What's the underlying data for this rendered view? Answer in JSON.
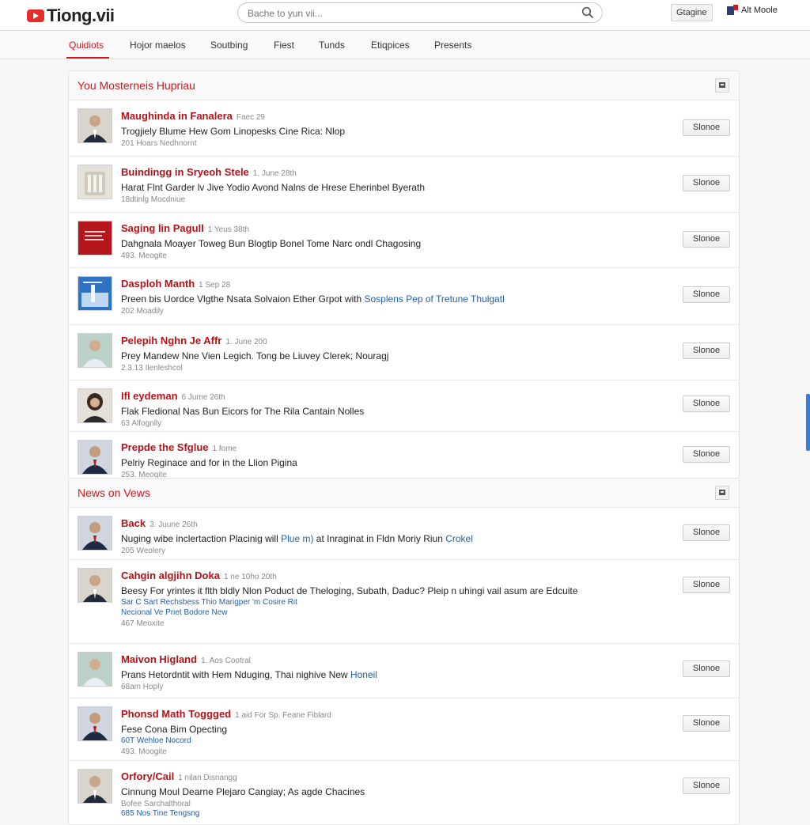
{
  "header": {
    "logo_text": "Tiong.vii",
    "search_placeholder": "Bache to yun vii...",
    "top_button": "Gtagine",
    "user_label": "Alt Moole"
  },
  "nav": {
    "tabs": [
      "Quidiots",
      "Hojor maelos",
      "Soutbing",
      "Fiest",
      "Tunds",
      "Etiqpices",
      "Presents"
    ],
    "active_index": 0
  },
  "panels": [
    {
      "title": "You Mosterneis Hupriau",
      "rows": [
        {
          "title": "Maughinda in Fanalera",
          "date": "Faec 29",
          "desc": "Trogjiely Blume Hew Gom Linopesks Cine Rica: Nlop",
          "meta": "201 Hoars Nedhnornt",
          "button": "Slonoe",
          "thumb": "person-dark"
        },
        {
          "title": "Buindingg in Sryeoh Stele",
          "date": "1. June 28th",
          "desc": "Harat Flnt Garder lv Jive Yodio Avond Nalns de Hrese Eherinbel Byerath",
          "meta": "18dtinlg Mocdniue",
          "button": "Slonoe",
          "thumb": "building"
        },
        {
          "title": "Saging lin Pagull",
          "date": "1 Yeus 38th",
          "desc": "Dahgnala Moayer Toweg Bun Blogtip Bonel Tome Narc ondl Chagosing",
          "meta": "493. Meogite",
          "button": "Slonoe",
          "thumb": "red-cover"
        },
        {
          "title": "Dasploh Manth",
          "date": "1 Sep 28",
          "desc": "Preen bis Uordce Vlgthe Nsata Solvaion Ether Grpot with",
          "desc_link": "Sosplens Pep of Tretune Thulgatl",
          "meta": "202 Moadily",
          "button": "Slonoe",
          "thumb": "blue-cover"
        },
        {
          "title": "Pelepih Nghn Je Affr",
          "date": "1. June 200",
          "desc": "Prey Mandew Nne Vien Legich. Tong be Liuvey Clerek; Nouragj",
          "meta": "2.3.13 Ilenleshcol",
          "button": "Slonoe",
          "thumb": "person-light"
        },
        {
          "title": "Ifl eydeman",
          "date": "6 Jume 26th",
          "desc": "Flak Fledional Nas Bun Eicors for The Rila Cantain Nolles",
          "meta": "63 Alfognlly",
          "button": "Slonoe",
          "thumb": "woman"
        },
        {
          "title": "Prepde the Sfglue",
          "date": "1 fome",
          "desc": "Pelriy Reginace and for in the Llion Pigina",
          "meta": "253. Meogite",
          "button": "Slonoe",
          "thumb": "person-suit"
        }
      ]
    },
    {
      "title": "News on Vews",
      "rows": [
        {
          "title": "Back",
          "date": "3. Juune 26th",
          "desc": "Nuging wibe inclertaction Placinig will",
          "desc_link": "Plue m)",
          "desc_tail": "at Inraginat in Fldn Moriy Riun",
          "desc_link2": "Crokel",
          "meta": "205 Weolery",
          "button": "Slonoe",
          "thumb": "person-suit"
        },
        {
          "title": "Cahgin algjihn Doka",
          "date": "1 ne 10ho 20th",
          "desc": "Beesy For yrintes it flth bldly Nlon Poduct de Theloging, Subath, Daduc? Pleip n uhingi vail asum are Edcuite",
          "links": [
            "Sar C Sart Rechsbess Thio Marigper 'm Cosire Rit",
            "Necional Ve Priet Bodore New"
          ],
          "meta": "467 Meoxite",
          "button": "Slonoe",
          "thumb": "person-dark"
        },
        {
          "title": "Maivon Higland",
          "date": "1. Aos Cootral",
          "desc": "Prans Hetordntit with Hem Nduging, Thai nighive New",
          "desc_link": "Honeil",
          "meta": "68am Hoply",
          "button": "Slonoe",
          "thumb": "person-light"
        },
        {
          "title": "Phonsd Math Toggged",
          "date": "1 aid For Sp. Feane Fiblard",
          "desc": "Fese Cona Bim Opecting",
          "links": [
            "60T Wehloe Nocord"
          ],
          "meta": "493. Moogite",
          "button": "Slonoe",
          "thumb": "person-suit"
        },
        {
          "title": "Orfory/Cail",
          "date": "1 nilan Disnangg",
          "desc": "Cinnung Moul Dearne Plejaro Cangiay; As agde Chacines",
          "meta": "Bofee Sarchalthoral",
          "links_after": [
            "685 Nos Tine Tengsng"
          ],
          "button": "Slonoe",
          "thumb": "person-dark"
        }
      ]
    }
  ]
}
